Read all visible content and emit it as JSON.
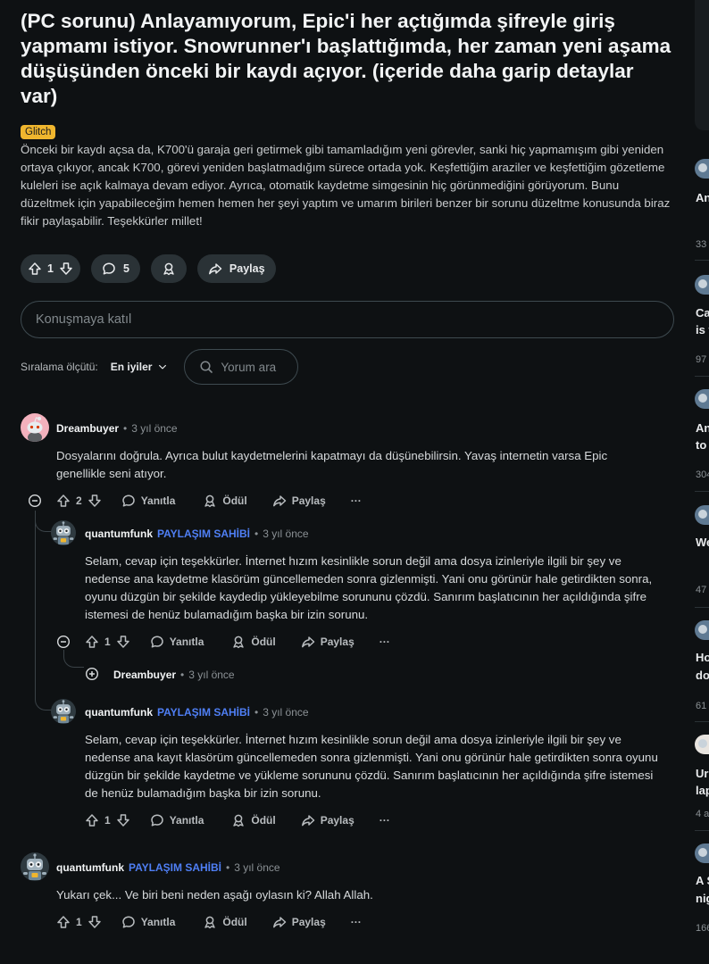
{
  "post": {
    "title": "(PC sorunu) Anlayamıyorum, Epic'i her açtığımda şifreyle giriş yapmamı istiyor. Snowrunner'ı başlattığımda, her zaman yeni aşama düşüşünden önceki bir kaydı açıyor. (içeride daha garip detaylar var)",
    "flair": "Glitch",
    "body": "Önceki bir kaydı açsa da, K700'ü garaja geri getirmek gibi tamamladığım yeni görevler, sanki hiç yapmamışım gibi yeniden ortaya çıkıyor, ancak K700, görevi yeniden başlatmadığım sürece ortada yok. Keşfettiğim araziler ve keşfettiğim gözetleme kuleleri ise açık kalmaya devam ediyor. Ayrıca, otomatik kaydetme simgesinin hiç görünmediğini görüyorum. Bunu düzeltmek için yapabileceğim hemen hemen her şeyi yaptım ve umarım birileri benzer bir sorunu düzeltme konusunda biraz fikir paylaşabilir. Teşekkürler millet!",
    "votes": "1",
    "comments": "5",
    "share": "Paylaş"
  },
  "join_placeholder": "Konuşmaya katıl",
  "sort": {
    "label": "Sıralama ölçütü:",
    "value": "En iyiler"
  },
  "search_placeholder": "Yorum ara",
  "labels": {
    "reply": "Yanıtla",
    "award": "Ödül",
    "share": "Paylaş",
    "op": "PAYLAŞIM SAHİBİ",
    "more": "···",
    "sep": "•"
  },
  "comments": [
    {
      "author": "Dreambuyer",
      "time": "3 yıl önce",
      "text": "Dosyalarını doğrula. Ayrıca bulut kaydetmelerini kapatmayı da düşünebilirsin. Yavaş internetin varsa Epic genellikle seni atıyor.",
      "votes": "2"
    },
    {
      "author": "quantumfunk",
      "time": "3 yıl önce",
      "text": "Selam, cevap için teşekkürler. İnternet hızım kesinlikle sorun değil ama dosya izinleriyle ilgili bir şey ve nedense ana kaydetme klasörüm güncellemeden sonra gizlenmişti. Yani onu görünür hale getirdikten sonra, oyunu düzgün bir şekilde kaydedip yükleyebilme sorununu çözdü. Sanırım başlatıcının her açıldığında şifre istemesi de henüz bulamadığım başka bir izin sorunu.",
      "votes": "1"
    },
    {
      "author": "Dreambuyer",
      "time": "3 yıl önce"
    },
    {
      "author": "quantumfunk",
      "time": "3 yıl önce",
      "text": "Selam, cevap için teşekkürler. İnternet hızım kesinlikle sorun değil ama dosya izinleriyle ilgili bir şey ve nedense ana kayıt klasörüm güncellemeden sonra gizlenmişti. Yani onu görünür hale getirdikten sonra oyunu düzgün bir şekilde kaydetme ve yükleme sorununu çözdü. Sanırım başlatıcının her açıldığında şifre istemesi de henüz bulamadığım başka bir izin sorunu.",
      "votes": "1"
    },
    {
      "author": "quantumfunk",
      "time": "3 yıl önce",
      "text": "Yukarı çek... Ve biri beni neden aşağı oylasın ki? Allah Allah.",
      "votes": "1"
    }
  ],
  "sidebar": [
    {
      "title": "An",
      "count": "33"
    },
    {
      "title": "Ca",
      "title2": "is t",
      "count": "97"
    },
    {
      "title": "An",
      "title2": "to",
      "count": "304"
    },
    {
      "title": "We",
      "count": "47"
    },
    {
      "title": "Ho",
      "title2": "do",
      "count": "61"
    },
    {
      "title": "Ur",
      "title2": "lap",
      "count": "4 a"
    },
    {
      "title": "A S",
      "title2": "nig",
      "count": "166"
    }
  ],
  "colors": {
    "background": "#0e1113",
    "pill": "#2a3236",
    "accent_op": "#4f7ff5",
    "flair": "#f0b62e"
  }
}
